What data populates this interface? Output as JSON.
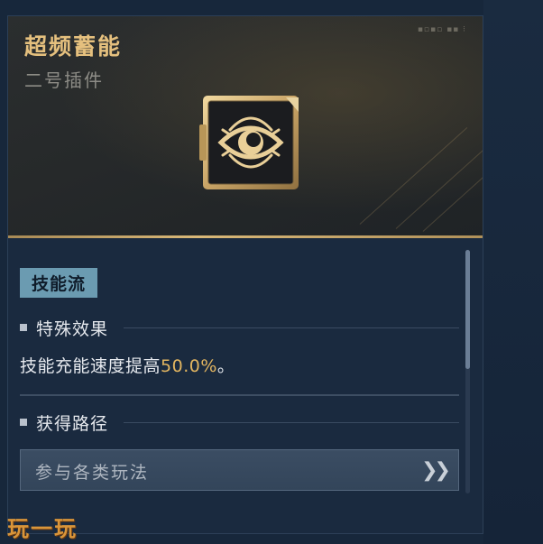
{
  "card": {
    "title": "超频蓄能",
    "subtitle": "二号插件",
    "tag": "技能流",
    "emblem_icon": "eye-icon"
  },
  "effect": {
    "heading": "特殊效果",
    "text_prefix": "技能充能速度提高",
    "value": "50.0%",
    "text_suffix": "。"
  },
  "acquisition": {
    "heading": "获得路径",
    "source_label": "参与各类玩法",
    "source_icon": "double-chevron-right-icon"
  },
  "watermark": {
    "text": "玩一玩"
  },
  "colors": {
    "title_gold": "#e5c07e",
    "value_gold": "#e2b560",
    "tag_bg": "#6b9bb1",
    "panel_bg": "#1a2a3f",
    "accent_line": "#d9b878"
  }
}
